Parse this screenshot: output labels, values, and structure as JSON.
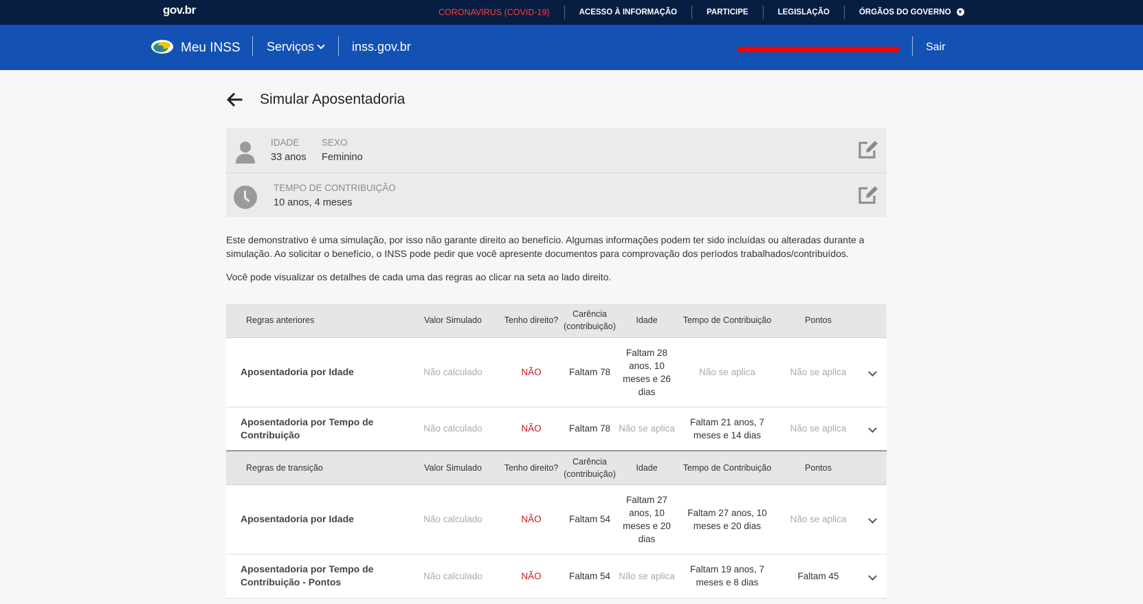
{
  "govbar": {
    "logo": "gov.br",
    "covid": "CORONAVÍRUS (COVID-19)",
    "links": [
      "ACESSO À INFORMAÇÃO",
      "PARTICIPE",
      "LEGISLAÇÃO",
      "ÓRGÃOS DO GOVERNO"
    ],
    "background": "#071d41",
    "covid_color": "#ff3d3d"
  },
  "header": {
    "brand": "Meu INSS",
    "servicos": "Serviços",
    "site": "inss.gov.br",
    "sair": "Sair",
    "background": "#1351b4"
  },
  "page": {
    "title": "Simular Aposentadoria"
  },
  "profile": {
    "idade_label": "IDADE",
    "idade_value": "33 anos",
    "sexo_label": "SEXO",
    "sexo_value": "Feminino",
    "tempo_label": "TEMPO DE CONTRIBUIÇÃO",
    "tempo_value": "10 anos, 4 meses"
  },
  "disclaimer": {
    "p1": "Este demonstrativo é uma simulação, por isso não garante direito ao benefício. Algumas informações podem ter sido incluídas ou alteradas durante a simulação. Ao solicitar o benefício, o INSS pode pedir que você apresente documentos para comprovação dos períodos trabalhados/contribuídos.",
    "p2": "Você pode visualizar os detalhes de cada uma das regras ao clicar na seta ao lado direito."
  },
  "table": {
    "columns": [
      "Valor Simulado",
      "Tenho direito?",
      "Carência (contribuição)",
      "Idade",
      "Tempo de Contribuição",
      "Pontos"
    ],
    "sections": [
      {
        "title": "Regras anteriores",
        "rows": [
          {
            "name": "Aposentadoria por Idade",
            "valor": "Não calculado",
            "direito": "NÃO",
            "carencia": "Faltam 78",
            "idade": "Faltam 28 anos, 10 meses e 26 dias",
            "tempo": "Não se aplica",
            "pontos": "Não se aplica"
          },
          {
            "name": "Aposentadoria por Tempo de Contribuição",
            "valor": "Não calculado",
            "direito": "NÃO",
            "carencia": "Faltam 78",
            "idade": "Não se aplica",
            "tempo": "Faltam 21 anos, 7 meses e 14 dias",
            "pontos": "Não se aplica"
          }
        ]
      },
      {
        "title": "Regras de transição",
        "rows": [
          {
            "name": "Aposentadoria por Idade",
            "valor": "Não calculado",
            "direito": "NÃO",
            "carencia": "Faltam 54",
            "idade": "Faltam 27 anos, 10 meses e 20 dias",
            "tempo": "Faltam 27 anos, 10 meses e 20 dias",
            "pontos": "Não se aplica"
          },
          {
            "name": "Aposentadoria por Tempo de Contribuição - Pontos",
            "valor": "Não calculado",
            "direito": "NÃO",
            "carencia": "Faltam 54",
            "idade": "Não se aplica",
            "tempo": "Faltam 19 anos, 7 meses e 8 dias",
            "pontos": "Faltam 45"
          }
        ]
      }
    ]
  }
}
